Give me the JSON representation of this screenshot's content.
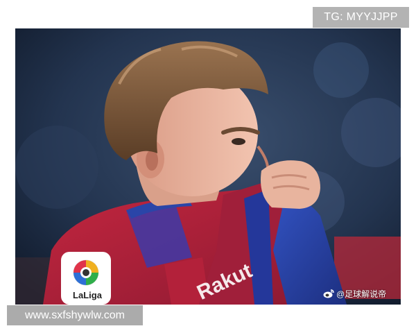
{
  "watermark_top": "TG: MYYJJPP",
  "watermark_bottom": "www.sxfshywlw.com",
  "credit": {
    "icon": "weibo-icon",
    "text": "@足球解说帝"
  },
  "badge": {
    "text": "LaLiga"
  },
  "colors": {
    "jersey_red": "#b3213a",
    "jersey_blue": "#2a45a8",
    "background": "#1a2940"
  }
}
